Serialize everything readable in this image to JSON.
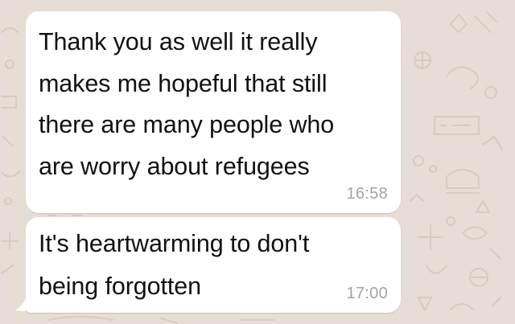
{
  "chat": {
    "background_color": "#e6ded4",
    "bubble_color": "#ffffff",
    "messages": [
      {
        "direction": "incoming",
        "text": "Thank you as well it really\nmakes me hopeful that still\nthere are many people who\nare worry about refugees",
        "time": "16:58"
      },
      {
        "direction": "incoming",
        "text": "It's heartwarming to don't\nbeing forgotten",
        "time": "17:00"
      }
    ]
  }
}
